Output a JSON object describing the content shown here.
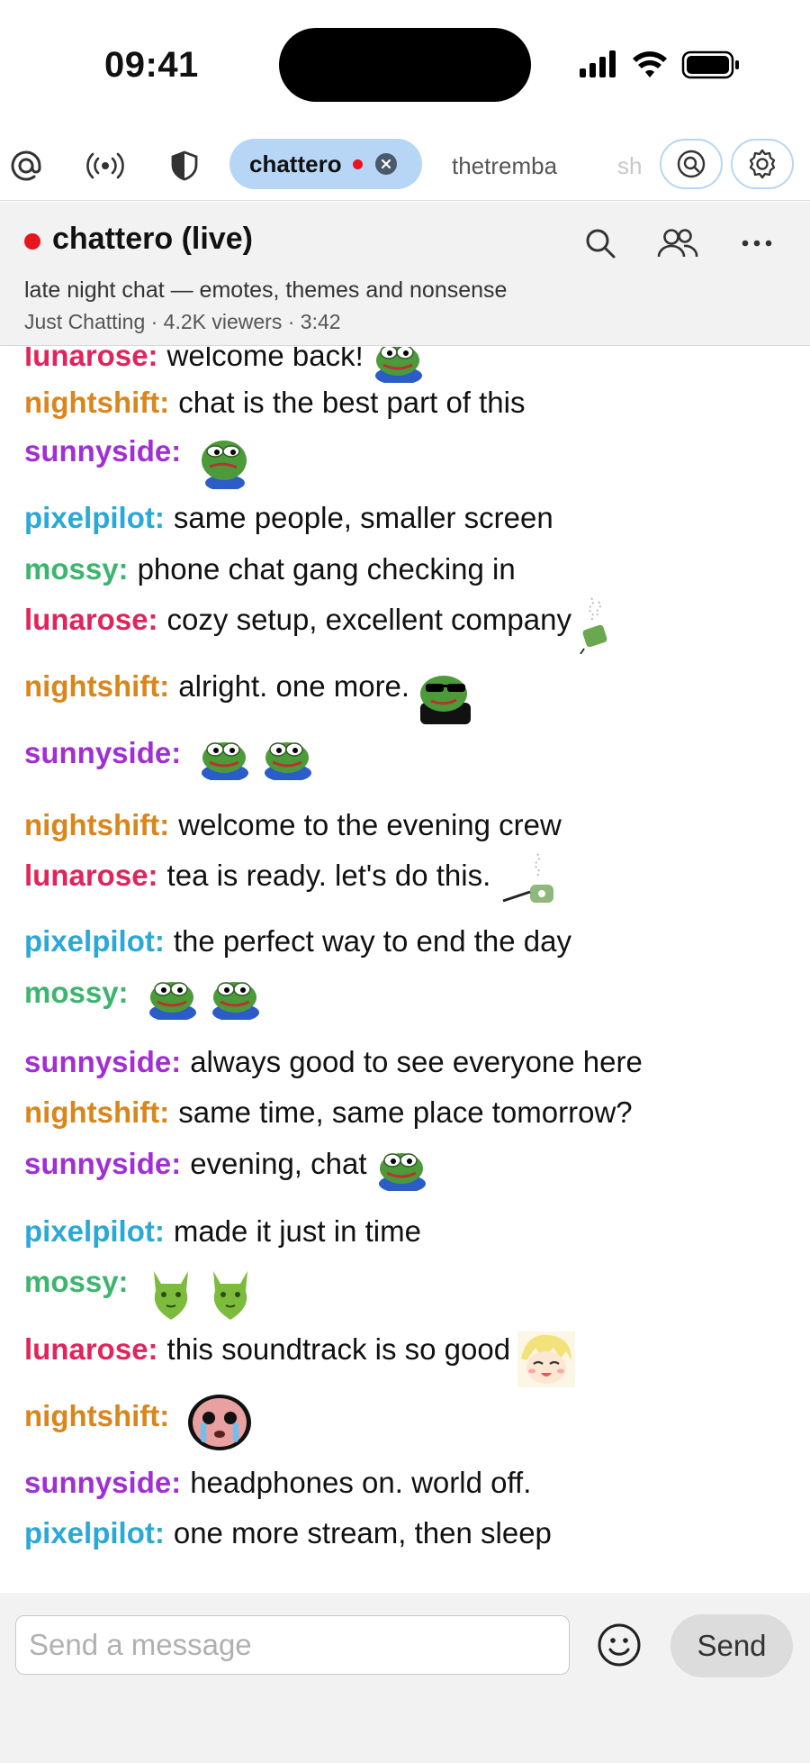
{
  "status_bar": {
    "time": "09:41",
    "icons": [
      "cellular-signal-icon",
      "wifi-icon",
      "battery-icon"
    ]
  },
  "tabs": {
    "active": {
      "label": "chattero",
      "live": true
    },
    "others": [
      {
        "label": "thetremba"
      },
      {
        "label": "sh"
      }
    ],
    "icons": [
      "mentions-icon",
      "live-broadcast-icon",
      "moderation-shield-icon",
      "search-channels-icon",
      "settings-gear-icon"
    ]
  },
  "channel": {
    "title": "chattero (live)",
    "stream_title": "late night chat — emotes, themes and nonsense",
    "meta": "Just Chatting · 4.2K viewers · 3:42"
  },
  "chat": {
    "messages": [
      {
        "user": "lunarose:",
        "text": "welcome back!",
        "color": "#e0245e",
        "emotes": [
          "pepe-happy"
        ]
      },
      {
        "user": "nightshift:",
        "text": "chat is the best part of this",
        "color": "#d9861c",
        "emotes": []
      },
      {
        "user": "sunnyside:",
        "text": "",
        "color": "#a12fd4",
        "emotes": [
          "pepe-sad"
        ]
      },
      {
        "user": "pixelpilot:",
        "text": "same people, smaller screen",
        "color": "#2aa8d6",
        "emotes": []
      },
      {
        "user": "mossy:",
        "text": "phone chat gang checking in",
        "color": "#3db56e",
        "emotes": []
      },
      {
        "user": "lunarose:",
        "text": "cozy setup, excellent company",
        "color": "#e0245e",
        "emotes": [
          "tea-cup"
        ]
      },
      {
        "user": "nightshift:",
        "text": "alright. one more.",
        "color": "#d9861c",
        "emotes": [
          "pepe-sunglasses"
        ]
      },
      {
        "user": "sunnyside:",
        "text": "",
        "color": "#a12fd4",
        "emotes": [
          "pepe-happy",
          "pepe-happy"
        ]
      },
      {
        "user": "nightshift:",
        "text": "welcome to the evening crew",
        "color": "#d9861c",
        "emotes": []
      },
      {
        "user": "lunarose:",
        "text": "tea is ready. let's do this.",
        "color": "#e0245e",
        "emotes": [
          "tea-pour"
        ]
      },
      {
        "user": "pixelpilot:",
        "text": "the perfect way to end the day",
        "color": "#2aa8d6",
        "emotes": []
      },
      {
        "user": "mossy:",
        "text": "",
        "color": "#3db56e",
        "emotes": [
          "pepe-happy",
          "pepe-happy"
        ]
      },
      {
        "user": "sunnyside:",
        "text": "always good to see everyone here",
        "color": "#a12fd4",
        "emotes": []
      },
      {
        "user": "nightshift:",
        "text": "same time, same place tomorrow?",
        "color": "#d9861c",
        "emotes": []
      },
      {
        "user": "sunnyside:",
        "text": "evening, chat",
        "color": "#a12fd4",
        "emotes": [
          "pepe-happy"
        ]
      },
      {
        "user": "pixelpilot:",
        "text": "made it just in time",
        "color": "#2aa8d6",
        "emotes": []
      },
      {
        "user": "mossy:",
        "text": "",
        "color": "#3db56e",
        "emotes": [
          "green-cat",
          "green-cat"
        ]
      },
      {
        "user": "lunarose:",
        "text": "this soundtrack is so good",
        "color": "#e0245e",
        "emotes": [
          "anime-girl"
        ]
      },
      {
        "user": "nightshift:",
        "text": "",
        "color": "#d9861c",
        "emotes": [
          "crying-blob"
        ]
      },
      {
        "user": "sunnyside:",
        "text": "headphones on. world off.",
        "color": "#a12fd4",
        "emotes": []
      },
      {
        "user": "pixelpilot:",
        "text": "one more stream, then sleep",
        "color": "#2aa8d6",
        "emotes": []
      }
    ]
  },
  "composer": {
    "placeholder": "Send a message",
    "send_label": "Send"
  }
}
